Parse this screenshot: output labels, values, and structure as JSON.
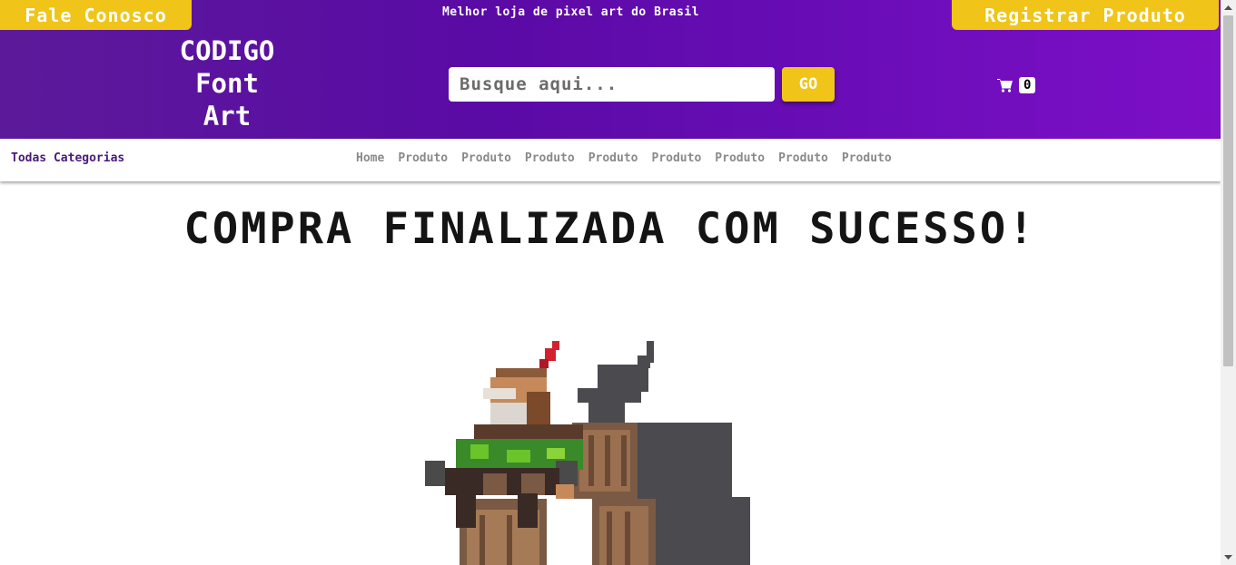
{
  "header": {
    "contact_button": "Fale Conosco",
    "tagline": "Melhor loja de pixel art do Brasil",
    "register_button": "Registrar Produto",
    "logo": {
      "line1": "CODIGO",
      "line2": "Font",
      "line3": "Art"
    },
    "search": {
      "placeholder": "Busque aqui...",
      "value": "",
      "button": "GO"
    },
    "cart": {
      "icon": "cart-icon",
      "count": "0"
    }
  },
  "nav": {
    "all_categories": "Todas Categorias",
    "links": [
      "Home",
      "Produto",
      "Produto",
      "Produto",
      "Produto",
      "Produto",
      "Produto",
      "Produto",
      "Produto"
    ]
  },
  "main": {
    "headline": "COMPRA FINALIZADA COM SUCESSO!",
    "illustration": "pixel-art-character-with-crates"
  },
  "colors": {
    "header_gradient_start": "#5c1a9a",
    "header_gradient_end": "#7d0fc7",
    "accent_yellow": "#f0c419",
    "nav_text": "#8a8a8a",
    "category_text": "#4a1a7a"
  }
}
